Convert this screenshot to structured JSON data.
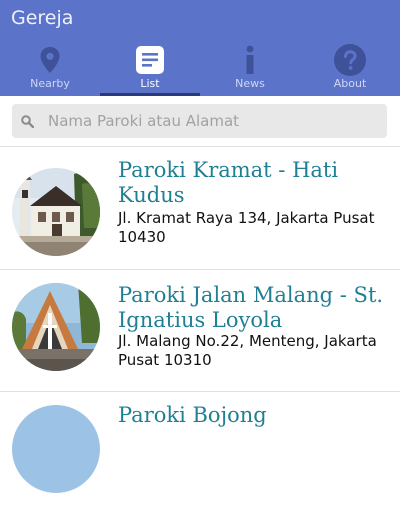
{
  "app": {
    "title": "Gereja",
    "accent": "#5b73c9",
    "title_color": "#1f7f93"
  },
  "tabs": [
    {
      "label": "Nearby",
      "icon": "location-pin-icon",
      "active": false
    },
    {
      "label": "List",
      "icon": "list-icon",
      "active": true
    },
    {
      "label": "News",
      "icon": "info-icon",
      "active": false
    },
    {
      "label": "About",
      "icon": "help-icon",
      "active": false
    }
  ],
  "search": {
    "placeholder": "Nama Paroki atau Alamat",
    "value": ""
  },
  "items": [
    {
      "name": "Paroki Kramat - Hati Kudus",
      "address": "Jl. Kramat Raya 134, Jakarta Pusat 10430"
    },
    {
      "name": "Paroki Jalan Malang - St. Ignatius Loyola",
      "address": "Jl. Malang No.22, Menteng, Jakarta Pusat 10310"
    },
    {
      "name": "Paroki Bojong"
    }
  ]
}
